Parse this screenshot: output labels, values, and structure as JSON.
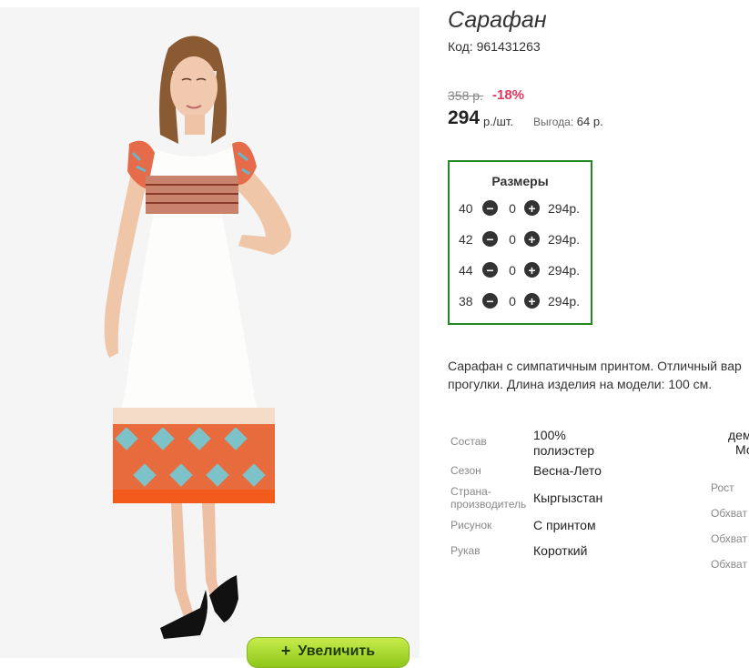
{
  "product": {
    "title": "Сарафан",
    "code": "Код: 961431263",
    "old_price": "358 р.",
    "discount": "-18%",
    "price": "294",
    "price_unit": "р./шт.",
    "saving_label": "Выгода:",
    "saving_value": "64 р."
  },
  "sizes": {
    "title": "Размеры",
    "rows": [
      {
        "size": "40",
        "qty": "0",
        "price": "294р."
      },
      {
        "size": "42",
        "qty": "0",
        "price": "294р."
      },
      {
        "size": "44",
        "qty": "0",
        "price": "294р."
      },
      {
        "size": "38",
        "qty": "0",
        "price": "294р."
      }
    ]
  },
  "description": {
    "line1": "Сарафан с симпатичным принтом. Отличный вар",
    "line2": "прогулки. Длина изделия на модели: 100 см."
  },
  "specs": [
    {
      "label": "Состав",
      "value": "100% полиэстер"
    },
    {
      "label": "Сезон",
      "value": "Весна-Лето"
    },
    {
      "label": "Страна-производитель",
      "value": "Кыргызстан"
    },
    {
      "label": "Рисунок",
      "value": "С принтом"
    },
    {
      "label": "Рукав",
      "value": "Короткий"
    }
  ],
  "right_specs": {
    "top1": "дем",
    "top2": "Мо",
    "labels": [
      "Рост",
      "Обхват",
      "Обхват",
      "Обхват"
    ]
  },
  "zoom_button": {
    "label": "Увеличить",
    "icon": "plus-icon"
  },
  "colors": {
    "accent_green": "#1f8a1f",
    "discount_red": "#e8335a",
    "button_green": "#a6d42e"
  }
}
